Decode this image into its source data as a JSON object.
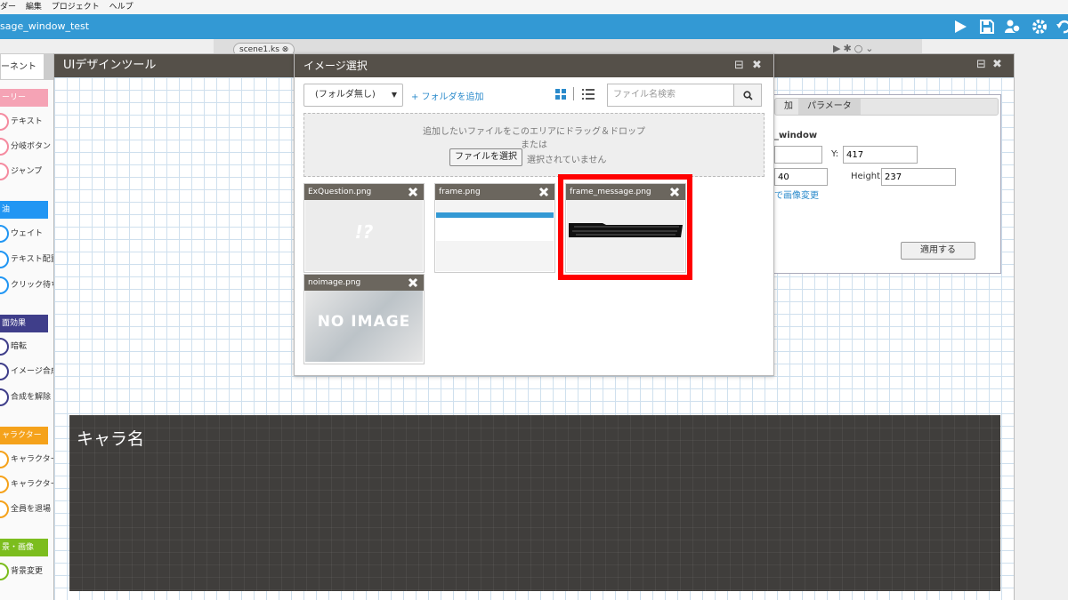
{
  "menubar": {
    "items": [
      "ダー",
      "編集",
      "プロジェクト",
      "ヘルプ"
    ]
  },
  "titlebar": {
    "project": "sage_window_test",
    "icons": [
      "play-icon",
      "save-icon",
      "users-icon",
      "gear-icon",
      "undo-icon"
    ]
  },
  "editor": {
    "scene_tab": "scene1.ks"
  },
  "left_panel": {
    "tab_label": "ーネント",
    "categories": [
      {
        "label": "ーリー",
        "color": "#f5a3b5"
      },
      {
        "label": "油",
        "color": "#2196f3"
      },
      {
        "label": "面効果",
        "color": "#3f3e8a"
      },
      {
        "label": "ャラクター",
        "color": "#f5a21b"
      },
      {
        "label": "景・画像",
        "color": "#7cbd1e"
      }
    ],
    "items": [
      {
        "label": "テキスト",
        "color": "#f58ba0"
      },
      {
        "label": "分岐ボタン",
        "color": "#f58ba0"
      },
      {
        "label": "ジャンプ",
        "color": "#f58ba0"
      },
      {
        "label": "ウェイト",
        "color": "#2196f3"
      },
      {
        "label": "テキスト配置",
        "color": "#2196f3"
      },
      {
        "label": "クリック待ち",
        "color": "#2196f3"
      },
      {
        "label": "暗転",
        "color": "#3f3e8a"
      },
      {
        "label": "イメージ合成",
        "color": "#3f3e8a"
      },
      {
        "label": "合成を解除",
        "color": "#3f3e8a"
      },
      {
        "label": "キャラクター",
        "color": "#f5a21b"
      },
      {
        "label": "キャラクター",
        "color": "#f5a21b"
      },
      {
        "label": "全員を退場",
        "color": "#f5a21b"
      },
      {
        "label": "背景変更",
        "color": "#7cbd1e"
      }
    ]
  },
  "ui_panel": {
    "title": "UIデザインツール",
    "message_box": {
      "char_name": "キャラ名"
    },
    "properties": {
      "tabs": [
        "加",
        "パラメータ"
      ],
      "name": "_window",
      "x_value": "",
      "y_label": "Y:",
      "y_value": "417",
      "width_value": "40",
      "height_label": "Height:",
      "height_value": "237",
      "image_change_link": "で画像変更",
      "apply_label": "適用する"
    }
  },
  "dialog": {
    "title": "イメージ選択",
    "folder_select": "(フォルダ無し)",
    "add_folder": "+ フォルダを追加",
    "search_placeholder": "ファイル名検索",
    "drop_text": "追加したいファイルをこのエリアにドラッグ＆ドロップ",
    "or_text": "または",
    "choose_file": "ファイルを選択",
    "no_file": "選択されていません",
    "files": [
      {
        "name": "ExQuestion.png",
        "preview_text": "!?"
      },
      {
        "name": "frame.png"
      },
      {
        "name": "frame_message.png"
      },
      {
        "name": "noimage.png",
        "preview_text": "NO IMAGE"
      }
    ]
  },
  "colors": {
    "accent": "#3399d4",
    "header": "#555049",
    "highlight": "#ff0000",
    "link": "#2a8acb"
  }
}
